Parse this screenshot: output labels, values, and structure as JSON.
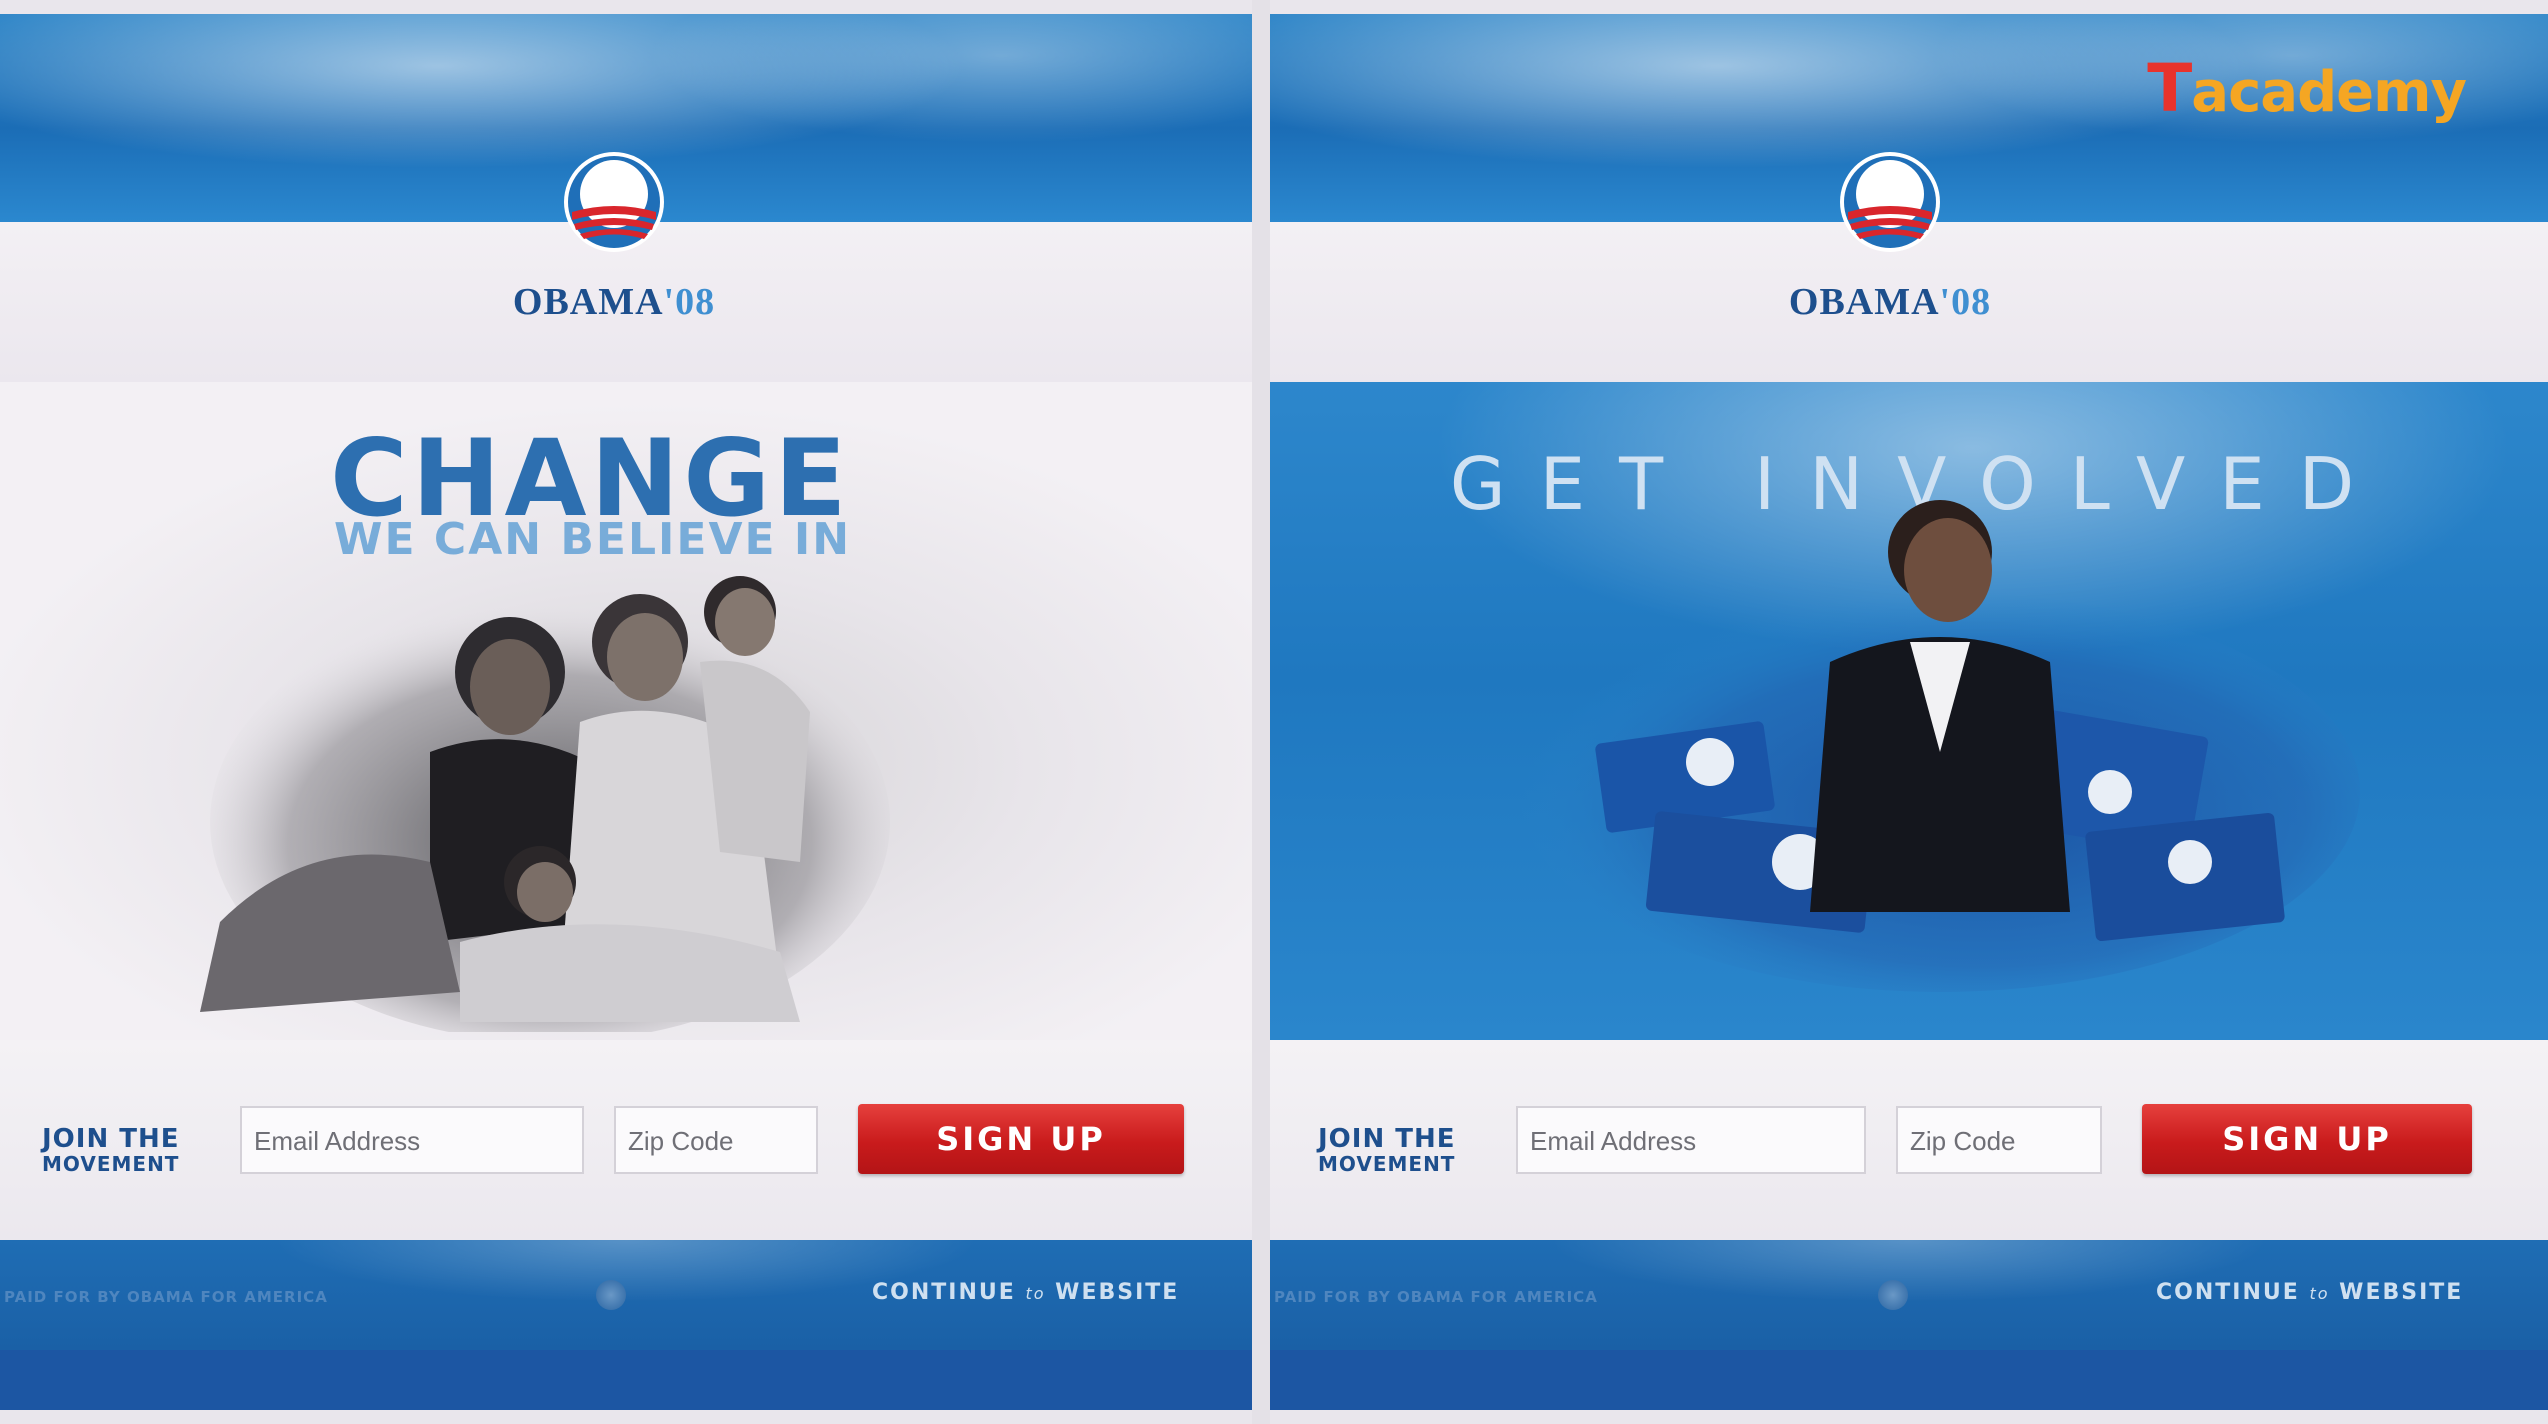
{
  "left_panel": {
    "logo": {
      "name": "OBAMA",
      "year": "'08"
    },
    "headline": "CHANGE",
    "subheadline": "WE CAN BELIEVE IN",
    "join_label_line1": "JOIN THE",
    "join_label_line2": "MOVEMENT",
    "email_placeholder": "Email Address",
    "zip_placeholder": "Zip Code",
    "signup_label": "SIGN UP",
    "paid_for": "PAID FOR BY OBAMA FOR AMERICA",
    "continue_label": "CONTINUE",
    "continue_to": "to",
    "continue_website": "WEBSITE"
  },
  "right_panel": {
    "logo": {
      "name": "OBAMA",
      "year": "'08"
    },
    "headline": "GET INVOLVED",
    "join_label_line1": "JOIN THE",
    "join_label_line2": "MOVEMENT",
    "email_placeholder": "Email Address",
    "zip_placeholder": "Zip Code",
    "signup_label": "SIGN UP",
    "paid_for": "PAID FOR BY OBAMA FOR AMERICA",
    "continue_label": "CONTINUE",
    "continue_to": "to",
    "continue_website": "WEBSITE"
  },
  "brand": {
    "t": "T",
    "rest": "academy"
  },
  "colors": {
    "brand_blue": "#1d4f8d",
    "sky_blue": "#2b88cf",
    "signup_red": "#c91b1c",
    "brand_orange": "#f5a623"
  }
}
